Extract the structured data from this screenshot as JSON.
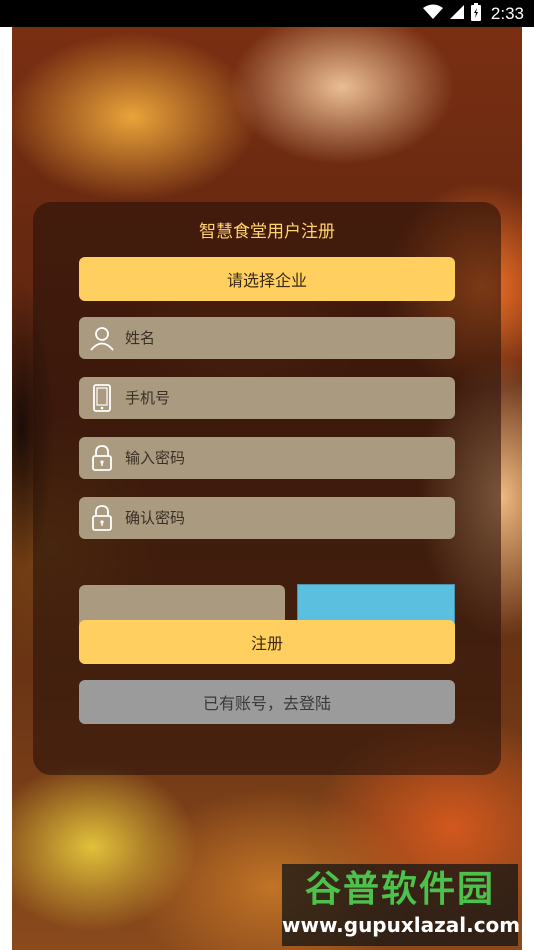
{
  "status_bar": {
    "time": "2:33",
    "icons": [
      "wifi-icon",
      "signal-icon",
      "battery-icon"
    ]
  },
  "register": {
    "title": "智慧食堂用户注册",
    "select_company_label": "请选择企业",
    "name_placeholder": "姓名",
    "phone_placeholder": "手机号",
    "password_placeholder": "输入密码",
    "confirm_password_placeholder": "确认密码",
    "captcha_placeholder": "",
    "submit_label": "注册",
    "login_link_label": "已有账号，去登陆"
  },
  "watermark": {
    "brand": "谷普软件园",
    "url": "www.gupuxlazal.com"
  },
  "colors": {
    "accent_yellow": "#ffd060",
    "title_yellow": "#ffd46a",
    "field_bg": "#a99a80",
    "captcha_bg": "#5bbfe0",
    "secondary_button": "#9b9b9b"
  }
}
